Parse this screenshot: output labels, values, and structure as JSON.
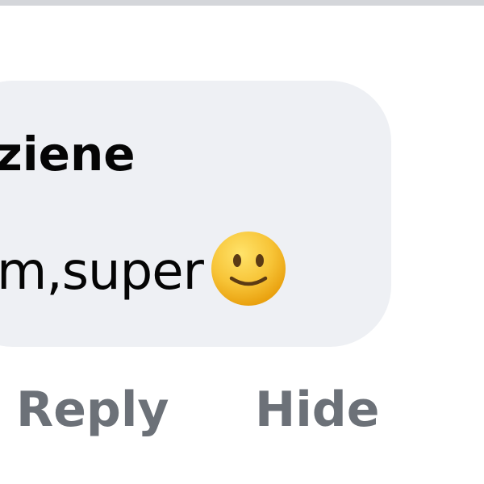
{
  "comment": {
    "author_partial": "ziene",
    "text_partial": "m,super",
    "emoji_icon": "slightly-smiling-face-icon"
  },
  "actions": {
    "reply_label": "Reply",
    "hide_label": "Hide"
  },
  "colors": {
    "bubble_background": "#eef0f4",
    "text_primary": "#050505",
    "action_text": "#6c7178",
    "divider": "#d4d6da"
  }
}
